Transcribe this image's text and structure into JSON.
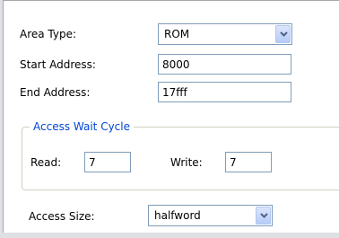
{
  "area_type": {
    "label": "Area Type:",
    "value": "ROM"
  },
  "start_address": {
    "label": "Start Address:",
    "value": "8000"
  },
  "end_address": {
    "label": "End Address:",
    "value": "17fff"
  },
  "access_wait_cycle": {
    "title": "Access Wait Cycle",
    "read_label": "Read:",
    "read_value": "7",
    "write_label": "Write:",
    "write_value": "7"
  },
  "access_size": {
    "label": "Access Size:",
    "value": "halfword"
  },
  "colors": {
    "group_title": "#0046d5",
    "input_border": "#7f9db9",
    "dropdown_button": "#c1d3fb"
  },
  "icons": {
    "dropdown": "chevron-down-icon"
  }
}
